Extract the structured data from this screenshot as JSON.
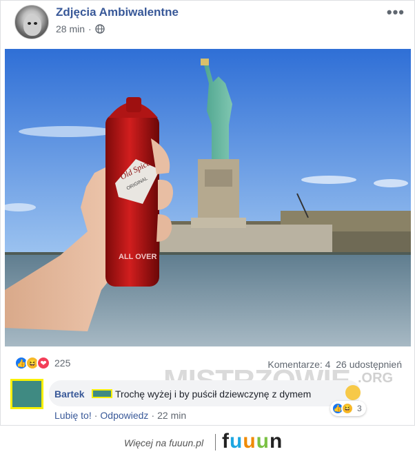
{
  "post": {
    "page_name": "Zdjęcia Ambiwalentne",
    "time": "28 min",
    "separator": "·",
    "more_icon": "more-dots-icon",
    "privacy_icon": "globe-icon"
  },
  "photo": {
    "icon": "photo-statue-of-liberty-deodorant",
    "can_brand": "Old Spice",
    "can_line1": "ORIGINAL",
    "can_line2": "ALL OVER"
  },
  "reactions": {
    "icons": [
      "like-icon",
      "haha-icon",
      "love-icon"
    ],
    "count": "225",
    "comments_label": "Komentarze: 4",
    "shares_label": "26 udostępnień"
  },
  "comment": {
    "author": "Bartek",
    "text": "Trochę wyżej i by puścił dziewczynę z dymem",
    "reaction_count": "3",
    "like_action": "Lubię to!",
    "reply_action": "Odpowiedz",
    "time": "22 min",
    "sep": "·"
  },
  "watermark": {
    "text": "MISTRZOWIE",
    "suffix": ".ORG"
  },
  "footer": {
    "more_on": "Więcej na fuuun.pl",
    "brand_letters": [
      "f",
      "u",
      "u",
      "u",
      "n"
    ]
  },
  "colors": {
    "link_blue": "#385898",
    "meta_gray": "#606770",
    "like_blue": "#1877f2",
    "love_red": "#f33e58",
    "haha_yellow": "#f7b928"
  }
}
